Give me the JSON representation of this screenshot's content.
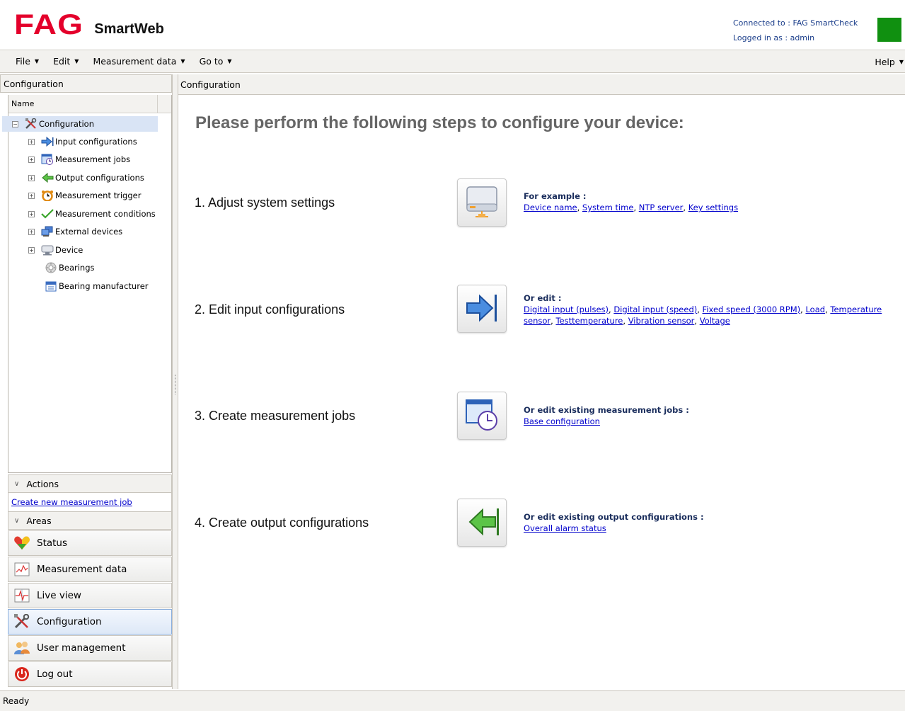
{
  "header": {
    "logo_brand": "FAG",
    "logo_product": "SmartWeb",
    "connected_label": "Connected to : FAG SmartCheck",
    "logged_in_label": "Logged in as : admin",
    "status_color": "#109010"
  },
  "menu": {
    "items": [
      {
        "label": "File"
      },
      {
        "label": "Edit"
      },
      {
        "label": "Measurement data"
      },
      {
        "label": "Go to"
      }
    ],
    "help": "Help"
  },
  "sidebar": {
    "title": "Configuration",
    "column_header": "Name",
    "tree": [
      {
        "label": "Configuration",
        "icon": "tools-icon"
      },
      {
        "label": "Input configurations",
        "icon": "arrow-right-icon"
      },
      {
        "label": "Measurement jobs",
        "icon": "clock-window-icon"
      },
      {
        "label": "Output configurations",
        "icon": "arrow-left-icon"
      },
      {
        "label": "Measurement trigger",
        "icon": "alarm-clock-icon"
      },
      {
        "label": "Measurement conditions",
        "icon": "checkmark-icon"
      },
      {
        "label": "External devices",
        "icon": "computers-icon"
      },
      {
        "label": "Device",
        "icon": "device-icon"
      },
      {
        "label": "Bearings",
        "icon": "bearing-icon"
      },
      {
        "label": "Bearing manufacturer",
        "icon": "calendar-icon"
      }
    ],
    "actions_header": "Actions",
    "actions": [
      {
        "label": "Create new measurement job"
      }
    ],
    "areas_header": "Areas",
    "areas": [
      {
        "label": "Status",
        "icon": "heart-status-icon"
      },
      {
        "label": "Measurement data",
        "icon": "chart-icon"
      },
      {
        "label": "Live view",
        "icon": "live-graph-icon"
      },
      {
        "label": "Configuration",
        "icon": "tools-icon"
      },
      {
        "label": "User management",
        "icon": "users-icon"
      },
      {
        "label": "Log out",
        "icon": "power-icon"
      }
    ]
  },
  "main": {
    "header": "Configuration",
    "headline": "Please perform the following steps to configure your device:",
    "steps": [
      {
        "title": "1. Adjust system settings",
        "icon": "hard-drive-icon",
        "label": "For example :",
        "links": [
          "Device name",
          "System time",
          "NTP server",
          "Key settings"
        ]
      },
      {
        "title": "2. Edit input configurations",
        "icon": "arrow-right-icon",
        "label": "Or edit :",
        "links": [
          "Digital input (pulses)",
          "Digital input (speed)",
          "Fixed speed (3000 RPM)",
          "Load",
          "Temperature sensor",
          "Testtemperature",
          "Vibration sensor",
          "Voltage"
        ]
      },
      {
        "title": "3. Create measurement jobs",
        "icon": "clock-window-icon",
        "label": "Or edit existing measurement jobs :",
        "links": [
          "Base configuration"
        ]
      },
      {
        "title": "4. Create output configurations",
        "icon": "arrow-left-icon",
        "label": "Or edit existing output configurations :",
        "links": [
          "Overall alarm status"
        ]
      }
    ]
  },
  "statusbar": {
    "text": "Ready"
  }
}
